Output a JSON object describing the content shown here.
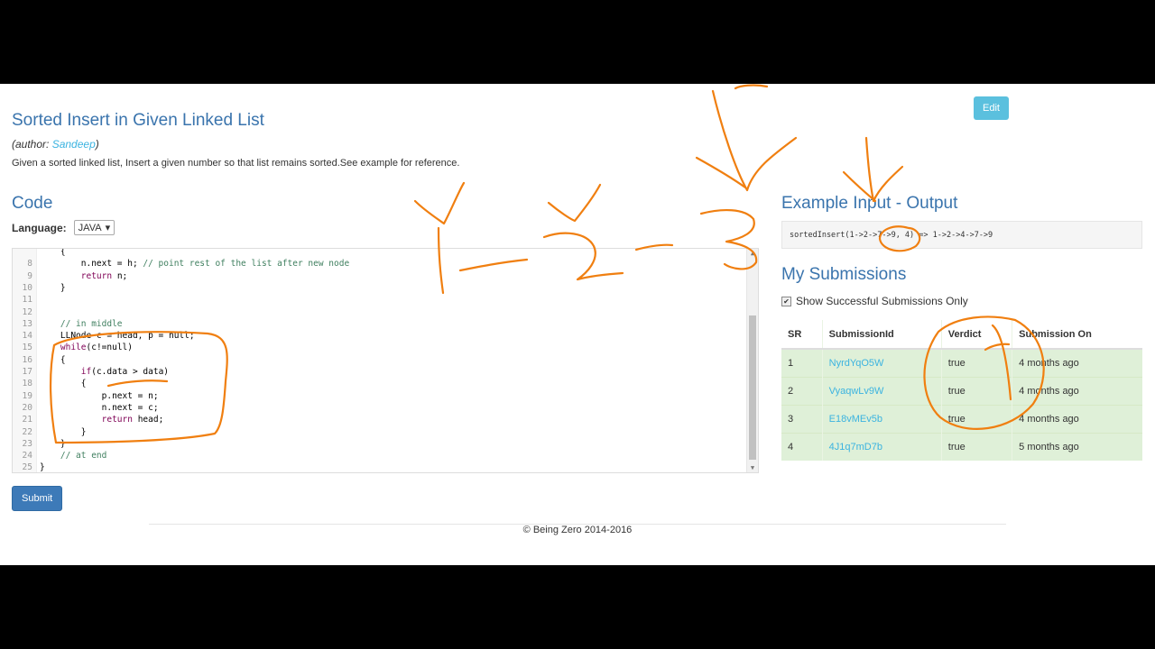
{
  "problem": {
    "title": "Sorted Insert in Given Linked List",
    "author_prefix": "(author: ",
    "author_name": "Sandeep",
    "author_suffix": ")",
    "description": "Given a sorted linked list, Insert a given number so that list remains sorted.See example for reference."
  },
  "code_section": {
    "heading": "Code",
    "language_label": "Language:",
    "language_value": "JAVA"
  },
  "editor_lines": [
    {
      "n": "",
      "text": "    {"
    },
    {
      "n": "8",
      "text": "        n.next = h; // point rest of the list after new node"
    },
    {
      "n": "9",
      "text": "        return n;"
    },
    {
      "n": "10",
      "text": "    }"
    },
    {
      "n": "11",
      "text": ""
    },
    {
      "n": "12",
      "text": ""
    },
    {
      "n": "13",
      "text": "    // in middle"
    },
    {
      "n": "14",
      "text": "    LLNode c = head, p = null;"
    },
    {
      "n": "15",
      "text": "    while(c!=null)"
    },
    {
      "n": "16",
      "text": "    {"
    },
    {
      "n": "17",
      "text": "        if(c.data > data)"
    },
    {
      "n": "18",
      "text": "        {"
    },
    {
      "n": "19",
      "text": "            p.next = n;"
    },
    {
      "n": "20",
      "text": "            n.next = c;"
    },
    {
      "n": "21",
      "text": "            return head;"
    },
    {
      "n": "22",
      "text": "        }"
    },
    {
      "n": "23",
      "text": "    }"
    },
    {
      "n": "24",
      "text": "    // at end"
    },
    {
      "n": "25",
      "text": "}"
    }
  ],
  "buttons": {
    "submit": "Submit",
    "edit": "Edit"
  },
  "example": {
    "heading": "Example Input - Output",
    "text": "sortedInsert(1->2->7->9, 4) => 1->2->4->7->9"
  },
  "submissions": {
    "heading": "My Submissions",
    "checkbox_label": "Show Successful Submissions Only",
    "columns": [
      "SR",
      "SubmissionId",
      "Verdict",
      "Submission On"
    ],
    "rows": [
      {
        "sr": "1",
        "id": "NyrdYqO5W",
        "verdict": "true",
        "on": "4 months ago"
      },
      {
        "sr": "2",
        "id": "VyaqwLv9W",
        "verdict": "true",
        "on": "4 months ago"
      },
      {
        "sr": "3",
        "id": "E18vMEv5b",
        "verdict": "true",
        "on": "4 months ago"
      },
      {
        "sr": "4",
        "id": "4J1q7mD7b",
        "verdict": "true",
        "on": "5 months ago"
      }
    ]
  },
  "footer": "© Being Zero 2014-2016",
  "colors": {
    "heading": "#3a74ad",
    "link": "#3bb3e0",
    "annotation": "#f07f10",
    "success_row": "#dff0d8"
  }
}
